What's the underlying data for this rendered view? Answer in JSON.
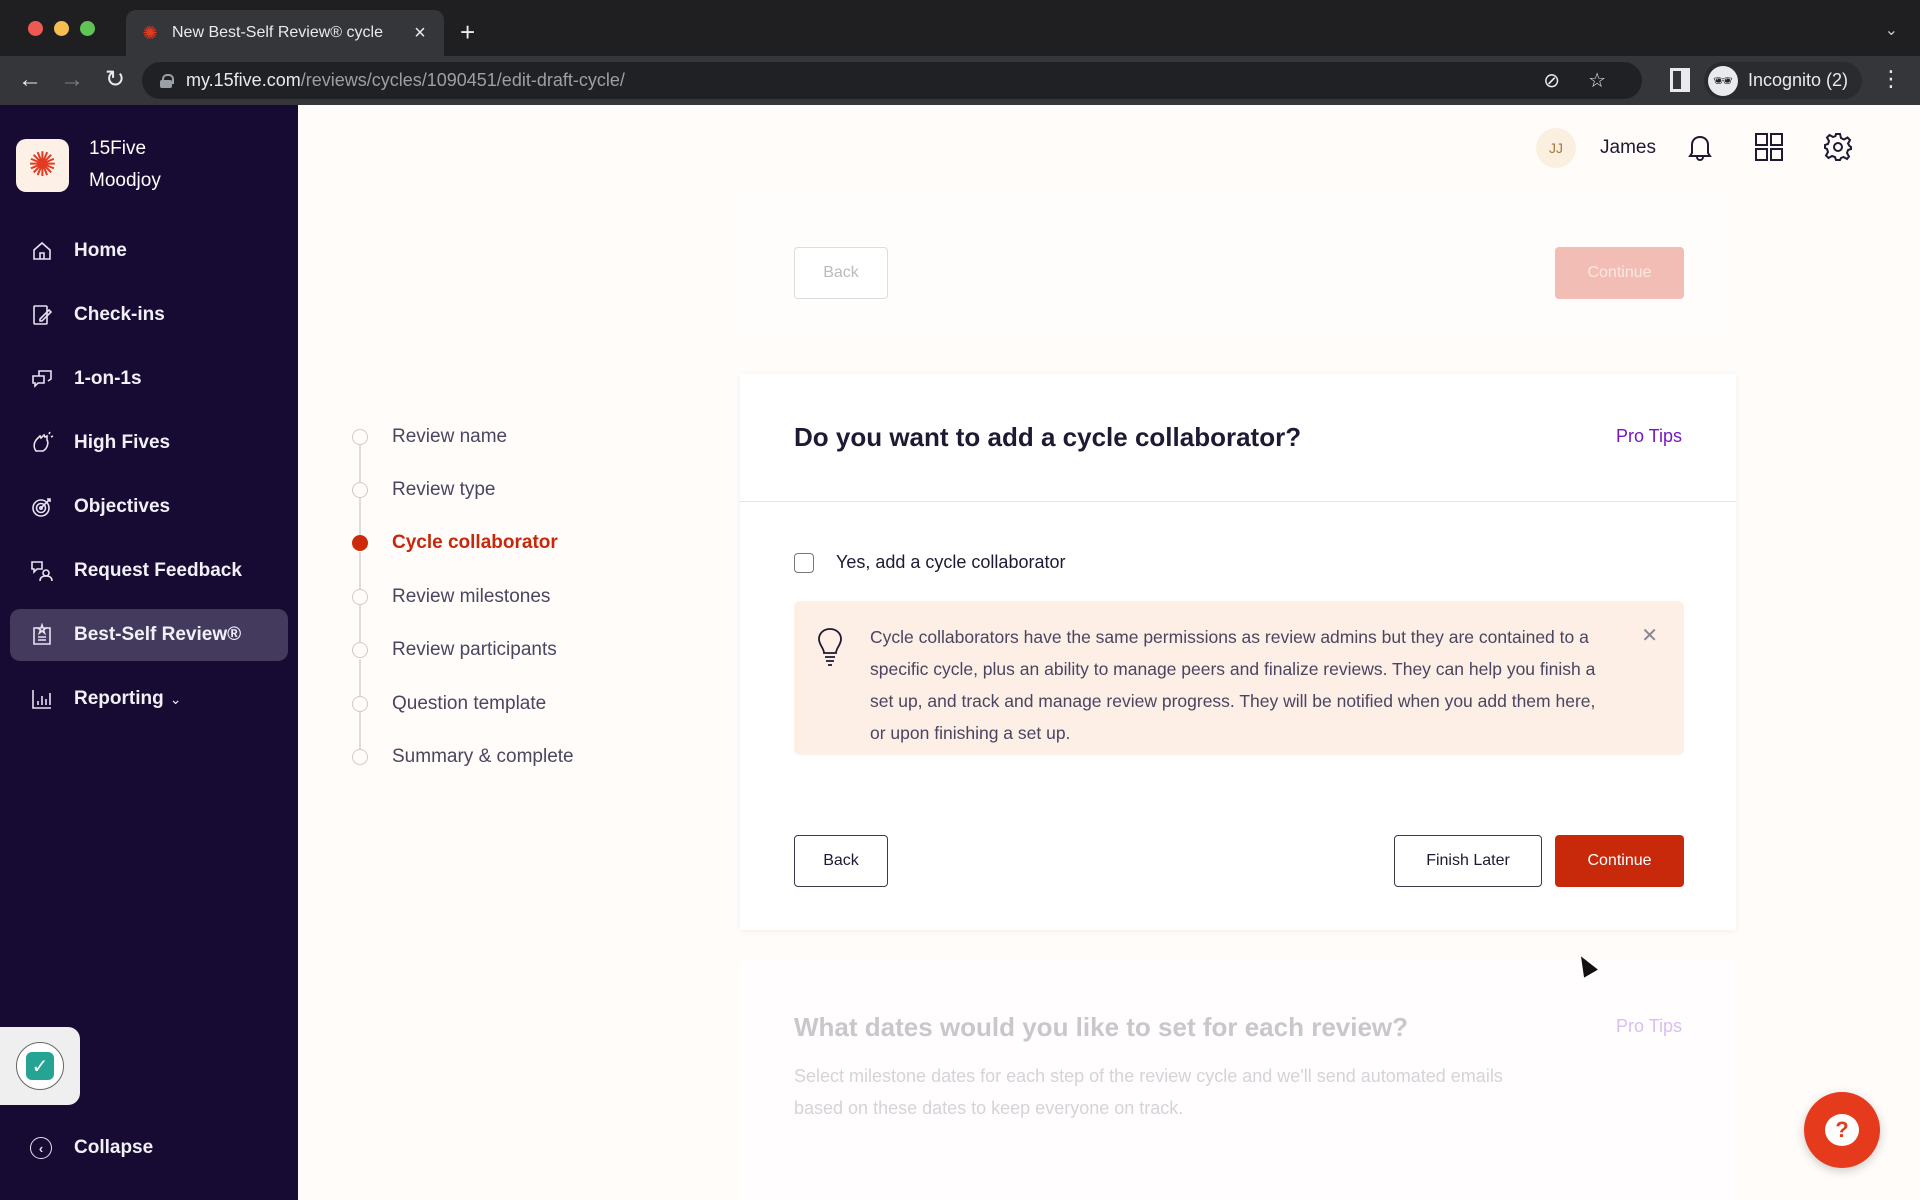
{
  "browser": {
    "tab_title": "New Best-Self Review® cycle",
    "tab_close": "×",
    "new_tab": "+",
    "url_host": "my.15five.com",
    "url_path": "/reviews/cycles/1090451/edit-draft-cycle/",
    "profile_label": "Incognito (2)",
    "icons": {
      "back": "←",
      "forward": "→",
      "reload": "↻",
      "eye_off": "⊘",
      "star": "☆",
      "kebab": "⋮",
      "dropdown": "⌄",
      "incognito": "🕶"
    }
  },
  "sidebar": {
    "brand_line1": "15Five",
    "brand_line2": "Moodjoy",
    "items": [
      {
        "label": "Home",
        "icon": "home-icon"
      },
      {
        "label": "Check-ins",
        "icon": "check-ins-icon"
      },
      {
        "label": "1-on-1s",
        "icon": "chat-icon"
      },
      {
        "label": "High Fives",
        "icon": "high-five-icon"
      },
      {
        "label": "Objectives",
        "icon": "target-icon"
      },
      {
        "label": "Request Feedback",
        "icon": "request-feedback-icon"
      },
      {
        "label": "Best-Self Review®",
        "icon": "review-icon",
        "active": true
      },
      {
        "label": "Reporting",
        "icon": "chart-icon",
        "chevron": "⌄"
      }
    ],
    "collapse_label": "Collapse",
    "collapse_icon": "‹"
  },
  "header": {
    "avatar_initials": "JJ",
    "user_name": "James"
  },
  "stepper": {
    "steps": [
      {
        "label": "Review name",
        "state": "pending"
      },
      {
        "label": "Review type",
        "state": "pending"
      },
      {
        "label": "Cycle collaborator",
        "state": "active"
      },
      {
        "label": "Review milestones",
        "state": "pending"
      },
      {
        "label": "Review participants",
        "state": "pending"
      },
      {
        "label": "Question template",
        "state": "pending"
      },
      {
        "label": "Summary & complete",
        "state": "pending"
      }
    ]
  },
  "previous_card": {
    "back_label": "Back",
    "continue_label": "Continue"
  },
  "card": {
    "title": "Do you want to add a cycle collaborator?",
    "pro_tips": "Pro Tips",
    "checkbox_label": "Yes, add a cycle collaborator",
    "checkbox_checked": false,
    "tip_text": "Cycle collaborators have the same permissions as review admins but they are contained to a specific cycle, plus an ability to manage peers and finalize reviews. They can help you finish a set up, and track and manage review progress. They will be notified when you add them here, or upon finishing a set up.",
    "tip_close": "✕",
    "back_label": "Back",
    "finish_later_label": "Finish Later",
    "continue_label": "Continue"
  },
  "next_card": {
    "title": "What dates would you like to set for each review?",
    "pro_tips": "Pro Tips",
    "description": "Select milestone dates for each step of the review cycle and we'll send automated emails based on these dates to keep everyone on track."
  },
  "widgets": {
    "help_glyph": "?",
    "check_glyph": "✓"
  },
  "colors": {
    "sidebar_bg": "#170a33",
    "accent_red": "#c8290b",
    "pro_tips_purple": "#7616c4",
    "tip_bg": "#fdeee6"
  }
}
